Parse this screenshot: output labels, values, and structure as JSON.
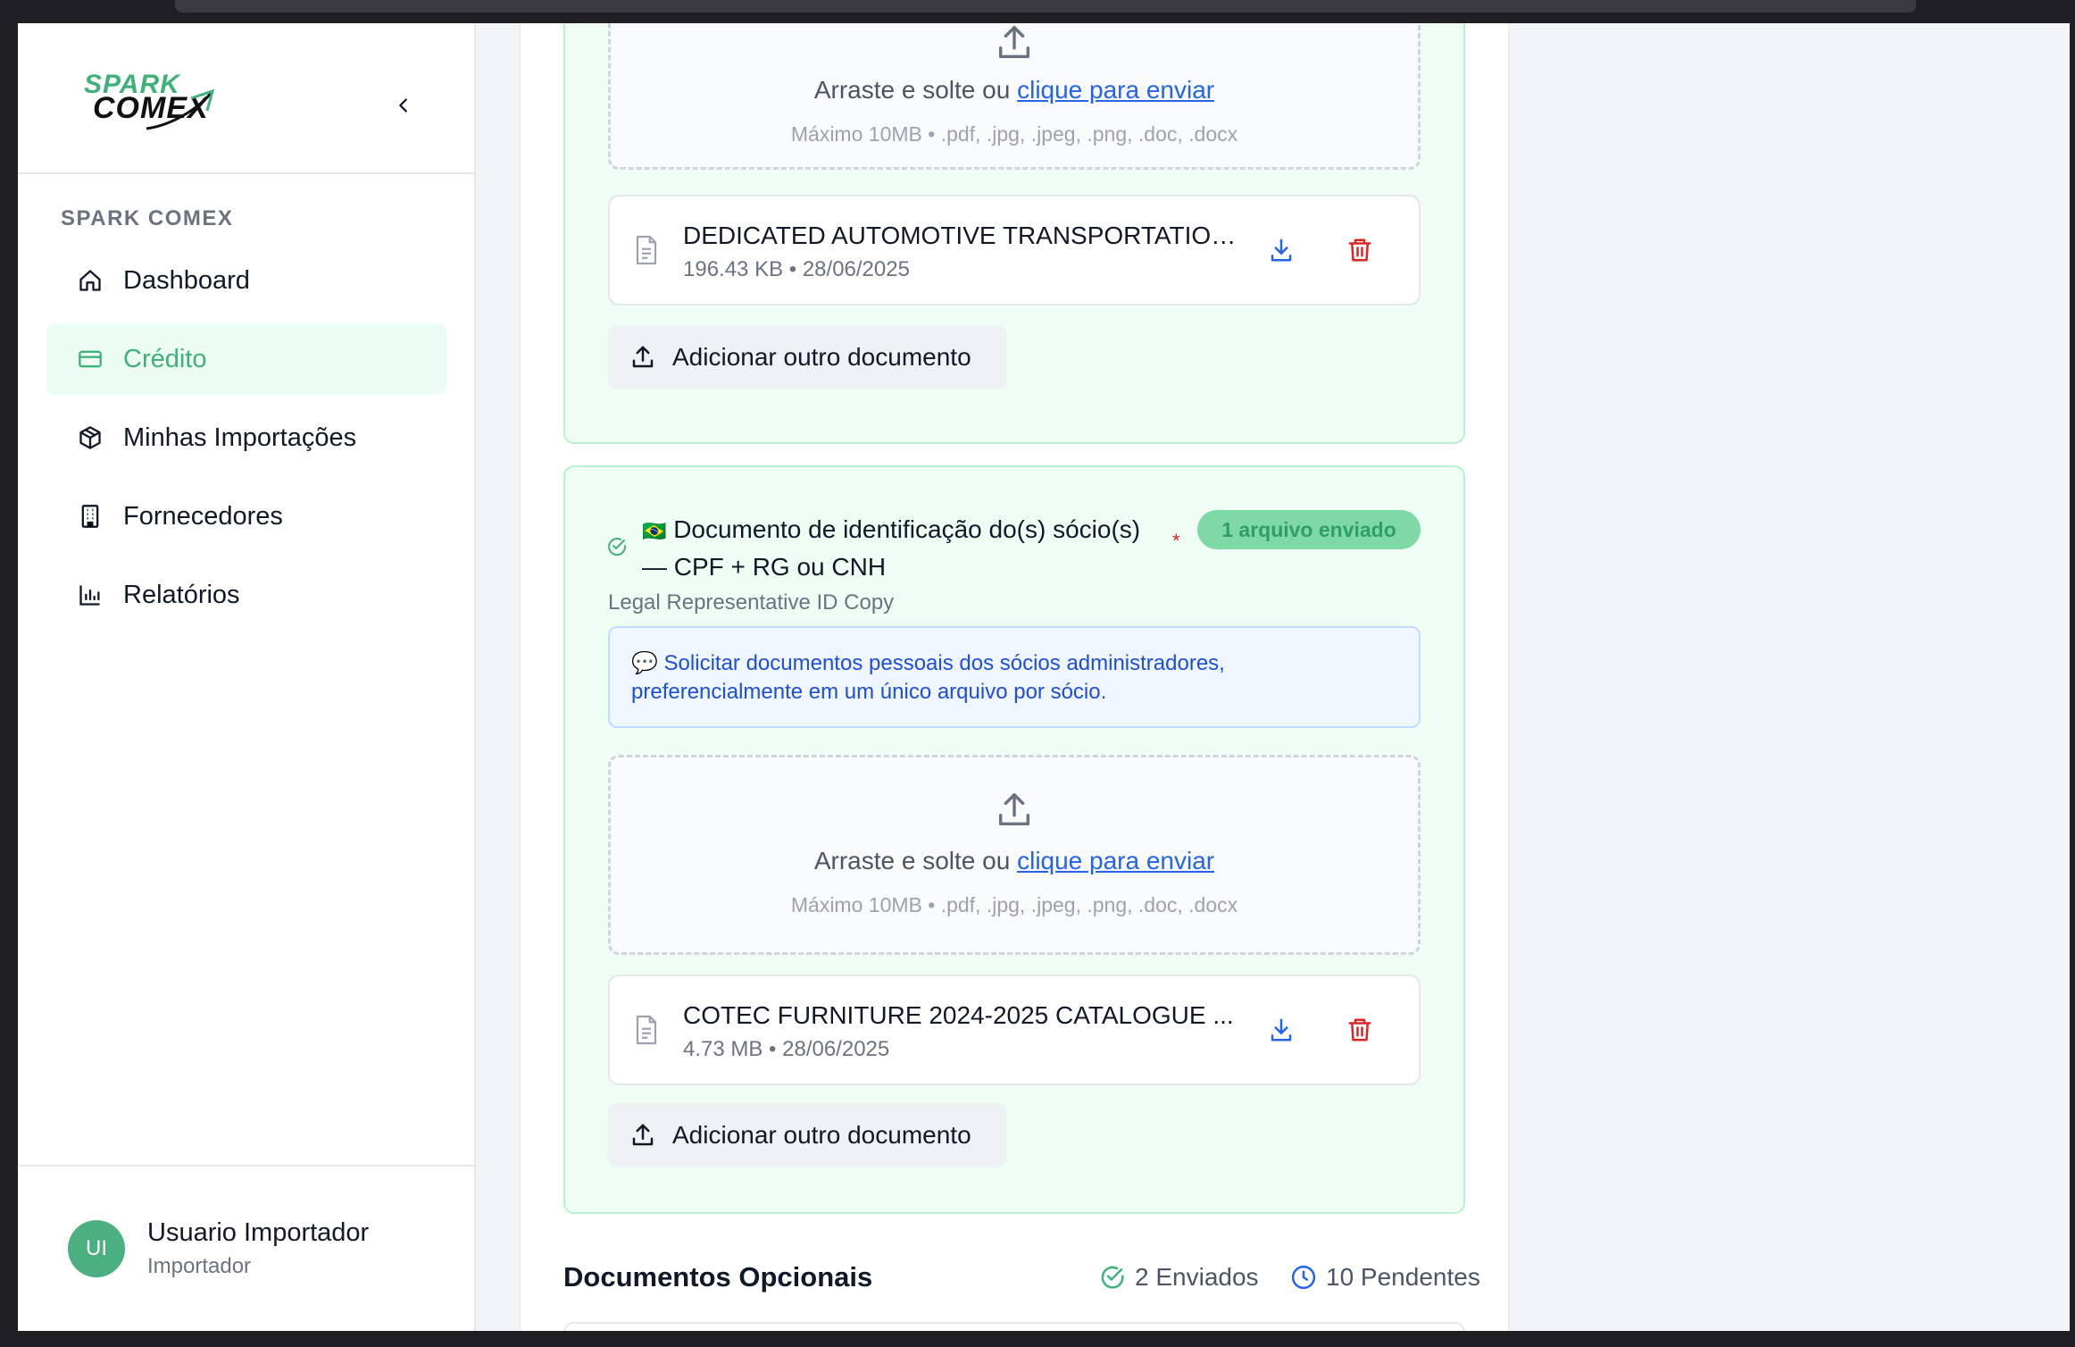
{
  "brand": {
    "line1": "SPARK",
    "line2": "COMEX",
    "primary": "#3fb27a"
  },
  "sidebar": {
    "section_label": "SPARK COMEX",
    "items": [
      {
        "label": "Dashboard",
        "icon": "home-icon",
        "active": false
      },
      {
        "label": "Crédito",
        "icon": "credit-card-icon",
        "active": true
      },
      {
        "label": "Minhas Importações",
        "icon": "package-icon",
        "active": false
      },
      {
        "label": "Fornecedores",
        "icon": "building-icon",
        "active": false
      },
      {
        "label": "Relatórios",
        "icon": "bar-chart-icon",
        "active": false
      }
    ],
    "user": {
      "initials": "UI",
      "name": "Usuario Importador",
      "role": "Importador"
    }
  },
  "dropzone": {
    "text": "Arraste e solte ou ",
    "link": "clique para enviar",
    "hint": "Máximo 10MB • .pdf, .jpg, .jpeg, .png, .doc, .docx"
  },
  "card1": {
    "file": {
      "name": "DEDICATED AUTOMOTIVE TRANSPORTATION...",
      "meta": "196.43 KB • 28/06/2025"
    },
    "add_label": "Adicionar outro documento"
  },
  "card2": {
    "flag": "🇧🇷",
    "title": "Documento de identificação do(s) sócio(s) — CPF + RG ou CNH",
    "required_mark": "*",
    "badge": "1 arquivo enviado",
    "subtitle": "Legal Representative ID Copy",
    "info": "💬 Solicitar documentos pessoais dos sócios administradores, preferencialmente em um único arquivo por sócio.",
    "file": {
      "name": "COTEC FURNITURE 2024-2025 CATALOGUE ...",
      "meta": "4.73 MB • 28/06/2025"
    },
    "add_label": "Adicionar outro documento"
  },
  "optional": {
    "title": "Documentos Opcionais",
    "sent": "2 Enviados",
    "pending": "10 Pendentes"
  }
}
